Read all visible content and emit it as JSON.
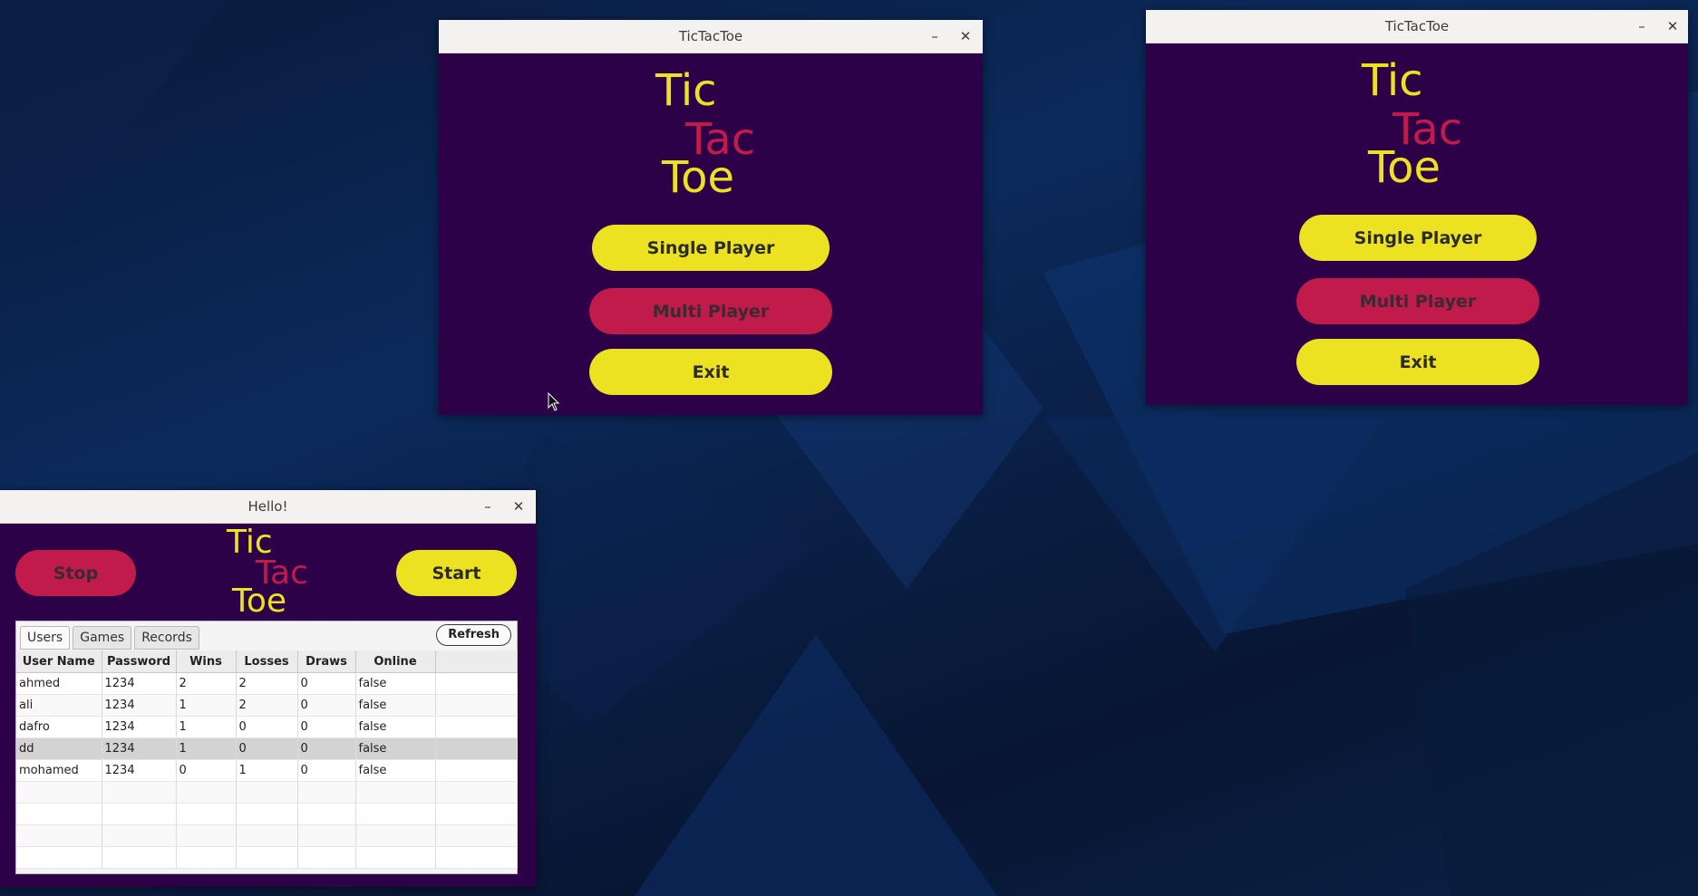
{
  "colors": {
    "window_bg": "#2d0148",
    "yellow": "#ece222",
    "crimson": "#c01b4a",
    "titlebar": "#f4f2f0"
  },
  "client_window_1": {
    "title": "TicTacToe",
    "minimize_glyph": "–",
    "close_glyph": "✕",
    "logo": {
      "tic": "Tic",
      "tac": "Tac",
      "toe": "Toe"
    },
    "buttons": {
      "single": "Single Player",
      "multi": "Multi Player",
      "exit": "Exit"
    }
  },
  "client_window_2": {
    "title": "TicTacToe",
    "minimize_glyph": "–",
    "close_glyph": "✕",
    "logo": {
      "tic": "Tic",
      "tac": "Tac",
      "toe": "Toe"
    },
    "buttons": {
      "single": "Single Player",
      "multi": "Multi Player",
      "exit": "Exit"
    }
  },
  "server_window": {
    "title": "Hello!",
    "minimize_glyph": "–",
    "close_glyph": "✕",
    "logo": {
      "tic": "Tic",
      "tac": "Tac",
      "toe": "Toe"
    },
    "stop_label": "Stop",
    "start_label": "Start",
    "tabs": [
      "Users",
      "Games",
      "Records"
    ],
    "active_tab": "Users",
    "refresh_label": "Refresh",
    "table": {
      "columns": [
        "User Name",
        "Password",
        "Wins",
        "Losses",
        "Draws",
        "Online"
      ],
      "rows": [
        [
          "ahmed",
          "1234",
          "2",
          "2",
          "0",
          "false"
        ],
        [
          "ali",
          "1234",
          "1",
          "2",
          "0",
          "false"
        ],
        [
          "dafro",
          "1234",
          "1",
          "0",
          "0",
          "false"
        ],
        [
          "dd",
          "1234",
          "1",
          "0",
          "0",
          "false"
        ],
        [
          "mohamed",
          "1234",
          "0",
          "1",
          "0",
          "false"
        ]
      ],
      "selected_row": 3,
      "empty_rows": 4
    }
  },
  "cursor_icon": "mouse-pointer-icon"
}
